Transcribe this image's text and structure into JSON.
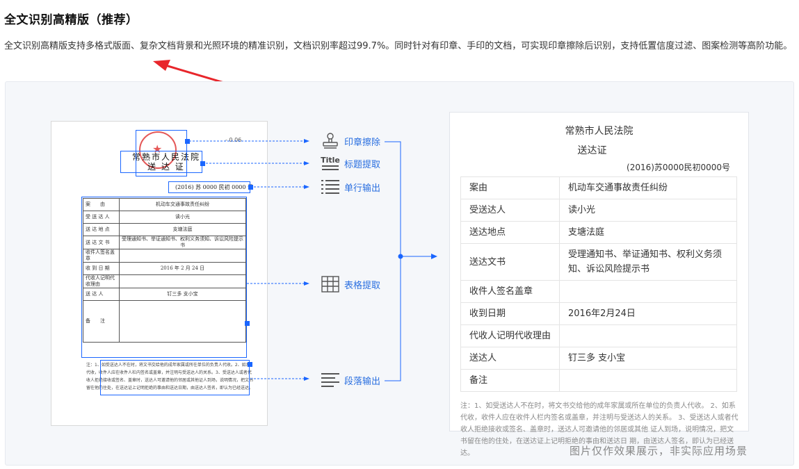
{
  "header": {
    "title": "全文识别高精版（推荐）",
    "description": "全文识别高精版支持多格式版面、复杂文档背景和光照环境的精准识别，文档识别率超过99.7%。同时针对有印章、手印的文档，可实现印章擦除后识别，支持低置信度过滤、图案检测等高阶功能。"
  },
  "scan": {
    "top_number": "- 0.06",
    "court_line1": "常熟市人民法院",
    "court_line2": "送 达 证",
    "case_no": "(2016) 苏 0000 民初 0000 号",
    "rows": [
      {
        "k": "案　　由",
        "v": "机动车交通事故责任纠纷"
      },
      {
        "k": "受 送 达 人",
        "v": "读小光"
      },
      {
        "k": "送 达 地 点",
        "v": "支塘法庭"
      },
      {
        "k": "送 达 文 书",
        "v": "受理通知书、举证通知书、权利义务须知、诉讼风险提示书"
      },
      {
        "k": "收件人签名盖章",
        "v": ""
      },
      {
        "k": "收 到 日 期",
        "v": "2016 年 2 月 24 日"
      },
      {
        "k": "代收人记明代收理由",
        "v": ""
      },
      {
        "k": "送 达 人",
        "v": "钉三多 支小宝"
      },
      {
        "k": "备　　注",
        "v": ""
      }
    ],
    "note": "注：1、如受送达人不在时，将文书交给他的成年家属或所在单位的负责人代收。2、如系代收，收件人应在收件人栏内签名或盖章，并注明与受送达人的关系。3、受送达人或者代收人拒绝接收或签名、盖章时，送达人可邀请他的邻居或其他证人到场，说明情况，把文书留在他的住处，在送达证上记明拒绝的事由和送达日期，由送达人签名，即认为已经送达。"
  },
  "features": {
    "stamp_erase": "印章擦除",
    "title_icon_text": "Title",
    "title_extract": "标题提取",
    "line_output": "单行输出",
    "table_extract": "表格提取",
    "paragraph_output": "段落输出"
  },
  "result": {
    "court": "常熟市人民法院",
    "doc_title": "送达证",
    "case_no": "(2016)苏0000民初0000号",
    "rows": [
      {
        "k": "案由",
        "v": "机动车交通事故责任纠纷"
      },
      {
        "k": "受送达人",
        "v": "读小光"
      },
      {
        "k": "送达地点",
        "v": "支塘法庭"
      },
      {
        "k": "送达文书",
        "v": "受理通知书、举证通知书、权利义务须知、诉讼风险提示书"
      },
      {
        "k": "收件人签名盖章",
        "v": ""
      },
      {
        "k": "收到日期",
        "v": "2016年2月24日"
      },
      {
        "k": "代收人记明代收理由",
        "v": ""
      },
      {
        "k": "送达人",
        "v": "钉三多 支小宝"
      },
      {
        "k": "备注",
        "v": ""
      }
    ],
    "note": "注：1、如受送达人不在时，将文书交给他的成年家属或所在单位的负责人代收。 2、如系代收，收件人应在收件人栏内签名或盖章，并注明与受送达人的关系。 3、受送达人或者代收人拒绝接收或签名、盖章时，送达人可邀请他的邻居或其他 证人到场，说明情况，把文书留在他的住处，在送达证上记明拒绝的事由和送达日 期，由送达人签名，即认为已经送达。"
  },
  "caption": "图片仅作效果展示，非实际应用场景",
  "colors": {
    "accent": "#1a66ff",
    "annotation_arrow": "#e8262b",
    "stamp": "#e03a3a"
  }
}
